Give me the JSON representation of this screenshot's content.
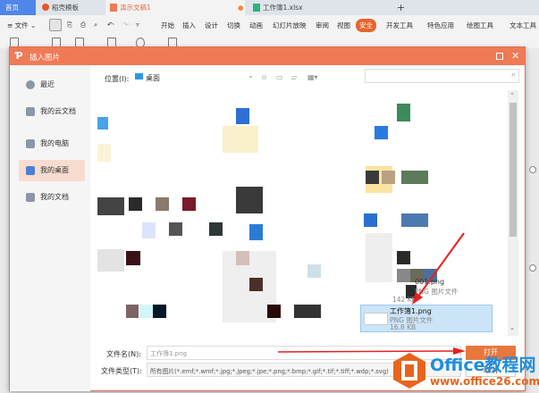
{
  "tabs": [
    {
      "label": "首页"
    },
    {
      "label": "稻壳模板"
    },
    {
      "label": "演示文稿1"
    },
    {
      "label": "工作簿1.xlsx"
    }
  ],
  "new_tab": "+",
  "menu": {
    "file": "文件",
    "items": [
      "开始",
      "插入",
      "设计",
      "切换",
      "动画",
      "幻灯片放映",
      "审阅",
      "视图",
      "安全",
      "开发工具",
      "特色应用",
      "绘图工具",
      "文本工具"
    ]
  },
  "dialog": {
    "title": "插入图片",
    "sidebar": [
      {
        "label": "最近"
      },
      {
        "label": "我的云文档"
      },
      {
        "label": "我的电脑"
      },
      {
        "label": "我的桌面"
      },
      {
        "label": "我的文档"
      }
    ],
    "location_label": "位置(I):",
    "location_value": "桌面",
    "files": [
      {
        "name": "001.png",
        "type": "PNG 图片文件",
        "size": "142 KB"
      },
      {
        "name": "工作簿1.png",
        "type": "PNG 图片文件",
        "size": "16.8 KB"
      }
    ],
    "filename_label": "文件名(N):",
    "filename_value": "工作簿1.png",
    "filetype_label": "文件类型(T):",
    "filetype_value": "所有图片(*.emf;*.wmf;*.jpg;*.jpeg;*.jpe;*.png;*.bmp;*.gif;*.tif;*.tiff;*.wdp;*.svg)",
    "open_label": "打开",
    "cancel_label": "取消"
  },
  "watermark": {
    "title": "Office教程网",
    "url": "www.office26.com"
  },
  "colors": {
    "accent": "#f07a55",
    "selected": "#cce4f7"
  }
}
